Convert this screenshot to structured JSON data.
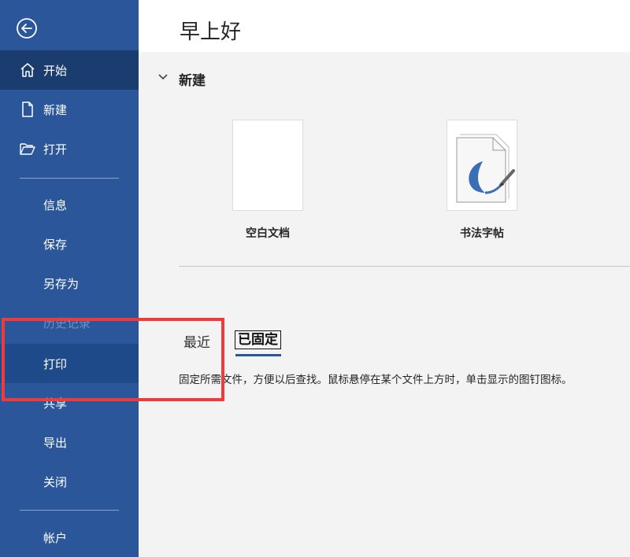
{
  "sidebar": {
    "items": [
      {
        "key": "home",
        "label": "开始",
        "icon": "home-icon"
      },
      {
        "key": "new",
        "label": "新建",
        "icon": "new-document-icon"
      },
      {
        "key": "open",
        "label": "打开",
        "icon": "open-folder-icon"
      },
      {
        "key": "info",
        "label": "信息"
      },
      {
        "key": "save",
        "label": "保存"
      },
      {
        "key": "save-as",
        "label": "另存为"
      },
      {
        "key": "history",
        "label": "历史记录"
      },
      {
        "key": "print",
        "label": "打印"
      },
      {
        "key": "share",
        "label": "共享"
      },
      {
        "key": "export",
        "label": "导出"
      },
      {
        "key": "close",
        "label": "关闭"
      },
      {
        "key": "account",
        "label": "帐户"
      }
    ]
  },
  "header": {
    "greeting": "早上好"
  },
  "new_section": {
    "title": "新建",
    "templates": [
      {
        "label": "空白文档"
      },
      {
        "label": "书法字帖"
      }
    ]
  },
  "tabs": {
    "recent": "最近",
    "pinned": "已固定"
  },
  "hint": "固定所需文件，方便以后查找。鼠标悬停在某个文件上方时，单击显示的图钉图标。",
  "colors": {
    "sidebar": "#2b579a",
    "sidebar_active": "#1b3c6f",
    "highlight": "#ee3b3b"
  }
}
